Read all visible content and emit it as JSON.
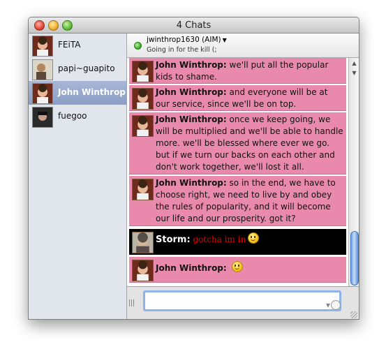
{
  "window": {
    "title": "4 Chats"
  },
  "contacts": [
    {
      "name": "FEiTA",
      "selected": false
    },
    {
      "name": "papi~guapito",
      "selected": false
    },
    {
      "name": "John Winthrop",
      "selected": true
    },
    {
      "name": "fuegoo",
      "selected": false
    }
  ],
  "chat_header": {
    "buddy": "jwinthrop1630 (AIM)",
    "status_text": "Going in for the kill (;",
    "status_color": "#2fa81d"
  },
  "messages": [
    {
      "sender": "John Winthrop:",
      "text": "we'll put all the popular kids to shame."
    },
    {
      "sender": "John Winthrop:",
      "text": "and everyone will be at our service, since we'll be on top."
    },
    {
      "sender": "John Winthrop:",
      "text": "once we keep going, we will be multiplied and we'll be able to handle more. we'll be blessed where ever we go. but if we turn our backs on each other and don't work together, we'll lost it all."
    },
    {
      "sender": "John Winthrop:",
      "text": "so in the end, we have to choose right, we need to live by and obey the rules of popularity, and it will become our life and our prosperity. got it?"
    },
    {
      "sender": "Storm:",
      "text": "gotcha im in"
    },
    {
      "sender": "John Winthrop:",
      "text": ""
    }
  ],
  "colors": {
    "incoming_bg": "#e98aac",
    "storm_bg": "#000000",
    "storm_text": "#e10000"
  },
  "icons": {
    "emoticon": "smiley-icon",
    "status": "online-dot-icon"
  }
}
